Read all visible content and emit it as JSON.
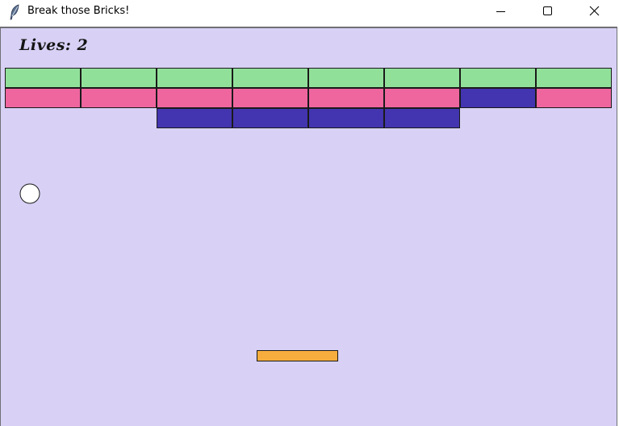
{
  "window": {
    "title": "Break those Bricks!",
    "icon": "feather-icon",
    "controls": [
      "minimize-icon",
      "maximize-icon",
      "close-icon"
    ]
  },
  "game": {
    "lives_text": "Lives: 2",
    "lives": 2,
    "colors": {
      "background": "#d8d1f5",
      "brick_green": "#91e09a",
      "brick_pink": "#ef669f",
      "brick_purple": "#4334af",
      "brick_outline": "#1a1a1a",
      "paddle": "#f7ad3e",
      "ball": "#ffffff"
    },
    "brick_rows": [
      [
        "green",
        "green",
        "green",
        "green",
        "green",
        "green",
        "green",
        "green"
      ],
      [
        "pink",
        "pink",
        "pink",
        "pink",
        "pink",
        "pink",
        "purple",
        "pink"
      ],
      [
        null,
        null,
        "purple",
        "purple",
        "purple",
        "purple",
        null,
        null
      ]
    ]
  }
}
